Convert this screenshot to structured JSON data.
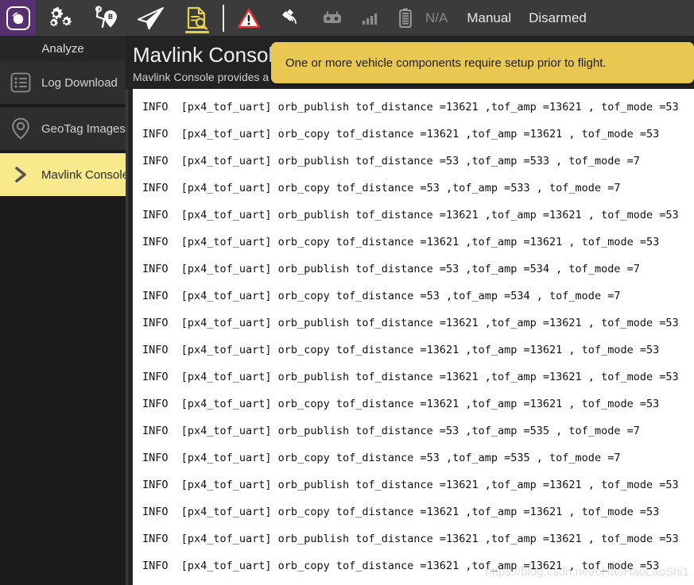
{
  "toolbar": {
    "logo_name": "QGroundControl",
    "accent_color": "#e8d24a",
    "logo_bg": "#57316f",
    "tools": [
      {
        "name": "settings-gears-icon",
        "label": "Vehicle Setup"
      },
      {
        "name": "plan-route-icon",
        "label": "Plan"
      },
      {
        "name": "fly-paperplane-icon",
        "label": "Fly"
      },
      {
        "name": "analyze-document-icon",
        "label": "Analyze",
        "active": true
      }
    ],
    "status": [
      {
        "name": "warning-triangle-icon",
        "label": "Warning"
      },
      {
        "name": "satellite-gps-icon",
        "label": "GPS"
      },
      {
        "name": "rc-controller-icon",
        "label": "RC"
      },
      {
        "name": "signal-bars-icon",
        "label": "Telemetry"
      },
      {
        "name": "battery-icon",
        "label": "Battery"
      }
    ],
    "battery_value": "N/A",
    "flight_mode": "Manual",
    "arm_state": "Disarmed"
  },
  "sidebar": {
    "header": "Analyze",
    "selected_color": "#f8ea8c",
    "items": [
      {
        "label": "Log Download",
        "icon": "list-lines-icon",
        "selected": false
      },
      {
        "label": "GeoTag Images",
        "icon": "map-pin-icon",
        "selected": false
      },
      {
        "label": "Mavlink Console",
        "icon": "chevron-right-icon",
        "selected": true
      }
    ]
  },
  "main": {
    "title": "Mavlink Console",
    "subtitle": "Mavlink Console provides a c"
  },
  "banner": {
    "message": "One or more vehicle components require setup prior to flight.",
    "background": "#e8c850"
  },
  "console": {
    "lines": [
      "INFO  [px4_tof_uart] orb_publish tof_distance =13621 ,tof_amp =13621 , tof_mode =53",
      "INFO  [px4_tof_uart] orb_copy tof_distance =13621 ,tof_amp =13621 , tof_mode =53",
      "INFO  [px4_tof_uart] orb_publish tof_distance =53 ,tof_amp =533 , tof_mode =7",
      "INFO  [px4_tof_uart] orb_copy tof_distance =53 ,tof_amp =533 , tof_mode =7",
      "INFO  [px4_tof_uart] orb_publish tof_distance =13621 ,tof_amp =13621 , tof_mode =53",
      "INFO  [px4_tof_uart] orb_copy tof_distance =13621 ,tof_amp =13621 , tof_mode =53",
      "INFO  [px4_tof_uart] orb_publish tof_distance =53 ,tof_amp =534 , tof_mode =7",
      "INFO  [px4_tof_uart] orb_copy tof_distance =53 ,tof_amp =534 , tof_mode =7",
      "INFO  [px4_tof_uart] orb_publish tof_distance =13621 ,tof_amp =13621 , tof_mode =53",
      "INFO  [px4_tof_uart] orb_copy tof_distance =13621 ,tof_amp =13621 , tof_mode =53",
      "INFO  [px4_tof_uart] orb_publish tof_distance =13621 ,tof_amp =13621 , tof_mode =53",
      "INFO  [px4_tof_uart] orb_copy tof_distance =13621 ,tof_amp =13621 , tof_mode =53",
      "INFO  [px4_tof_uart] orb_publish tof_distance =53 ,tof_amp =535 , tof_mode =7",
      "INFO  [px4_tof_uart] orb_copy tof_distance =53 ,tof_amp =535 , tof_mode =7",
      "INFO  [px4_tof_uart] orb_publish tof_distance =13621 ,tof_amp =13621 , tof_mode =53",
      "INFO  [px4_tof_uart] orb_copy tof_distance =13621 ,tof_amp =13621 , tof_mode =53",
      "INFO  [px4_tof_uart] orb_publish tof_distance =13621 ,tof_amp =13621 , tof_mode =53",
      "INFO  [px4_tof_uart] orb_copy tof_distance =13621 ,tof_amp =13621 , tof_mode =53"
    ]
  },
  "watermark": {
    "text": "https://blog.csdn.net/oHaoHaoLaoShi1"
  }
}
